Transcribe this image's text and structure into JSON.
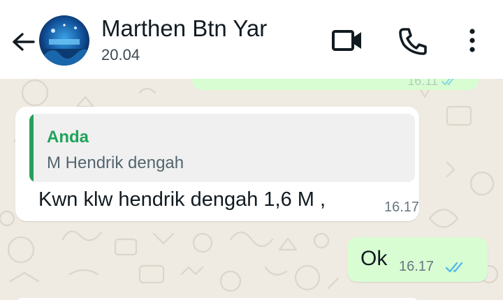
{
  "header": {
    "contact_name": "Marthen Btn Yar",
    "subtitle": "20.04",
    "icons": [
      "back-arrow-icon",
      "video-call-icon",
      "phone-icon",
      "more-options-icon"
    ]
  },
  "messages": {
    "previous_time": "16.11",
    "incoming": {
      "quoted_author": "Anda",
      "quoted_text": "M Hendrik dengah",
      "text": "Kwn klw hendrik dengah 1,6 M ,",
      "time": "16.17"
    },
    "outgoing": {
      "text": "Ok",
      "time": "16.17",
      "status": "read"
    }
  },
  "colors": {
    "outgoing_bubble": "#d9fdd3",
    "incoming_bubble": "#ffffff",
    "quote_accent": "#25a05c",
    "read_ticks": "#53bdeb",
    "wallpaper": "#efeae2"
  }
}
